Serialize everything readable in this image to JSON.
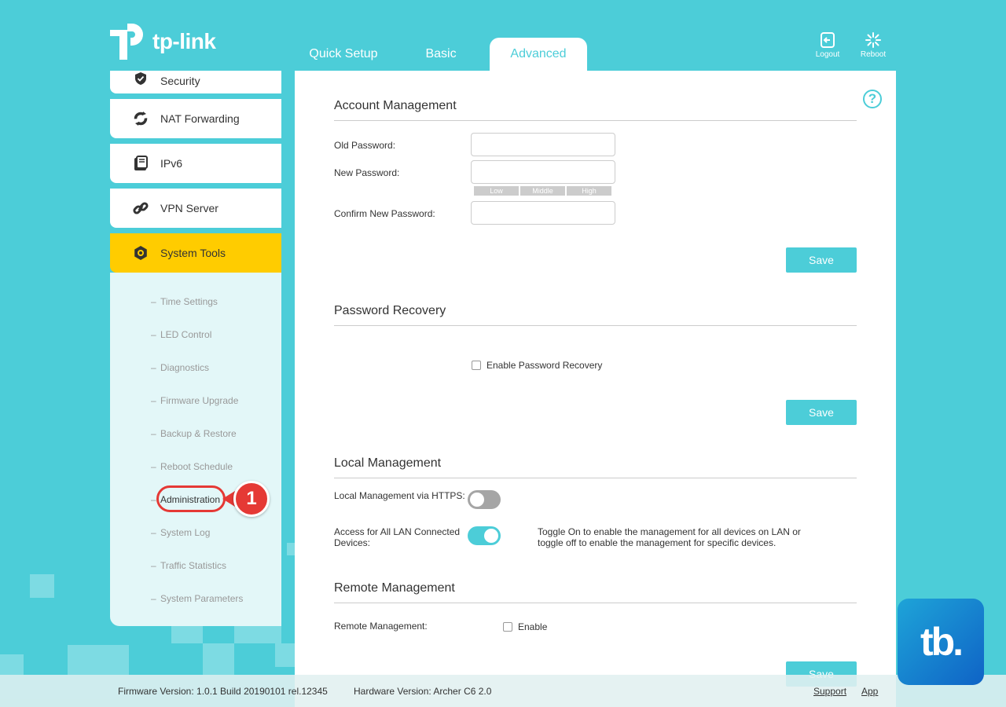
{
  "brand": {
    "name": "tp-link"
  },
  "nav": {
    "tabs": [
      {
        "label": "Quick Setup"
      },
      {
        "label": "Basic"
      },
      {
        "label": "Advanced"
      }
    ],
    "logout": "Logout",
    "reboot": "Reboot"
  },
  "sidebar": {
    "items": [
      {
        "label": "Security",
        "icon": "shield-check-icon"
      },
      {
        "label": "NAT Forwarding",
        "icon": "refresh-icon"
      },
      {
        "label": "IPv6",
        "icon": "document-icon"
      },
      {
        "label": "VPN Server",
        "icon": "link-icon"
      },
      {
        "label": "System Tools",
        "icon": "gear-icon"
      }
    ],
    "submenu": [
      "Time Settings",
      "LED Control",
      "Diagnostics",
      "Firmware Upgrade",
      "Backup & Restore",
      "Reboot Schedule",
      "Administration",
      "System Log",
      "Traffic Statistics",
      "System Parameters"
    ],
    "callout_number": "1"
  },
  "account": {
    "title": "Account Management",
    "old_password_label": "Old Password:",
    "new_password_label": "New Password:",
    "confirm_password_label": "Confirm New Password:",
    "strength": [
      "Low",
      "Middle",
      "High"
    ],
    "save": "Save"
  },
  "recovery": {
    "title": "Password Recovery",
    "checkbox_label": "Enable Password Recovery",
    "save": "Save"
  },
  "local": {
    "title": "Local Management",
    "https_label": "Local Management via HTTPS:",
    "lan_label": "Access for All LAN Connected Devices:",
    "hint": "Toggle On to enable the management for all devices on LAN or toggle off to enable the management for specific devices."
  },
  "remote": {
    "title": "Remote Management",
    "label": "Remote Management:",
    "checkbox_label": "Enable",
    "save": "Save"
  },
  "footer": {
    "firmware": "Firmware Version: 1.0.1 Build 20190101 rel.12345",
    "hardware": "Hardware Version: Archer C6 2.0",
    "support": "Support",
    "app": "App"
  },
  "watermark": "tb.",
  "colors": {
    "accent": "#4ccdd8",
    "active_menu": "#ffcc00",
    "callout": "#e53935"
  }
}
